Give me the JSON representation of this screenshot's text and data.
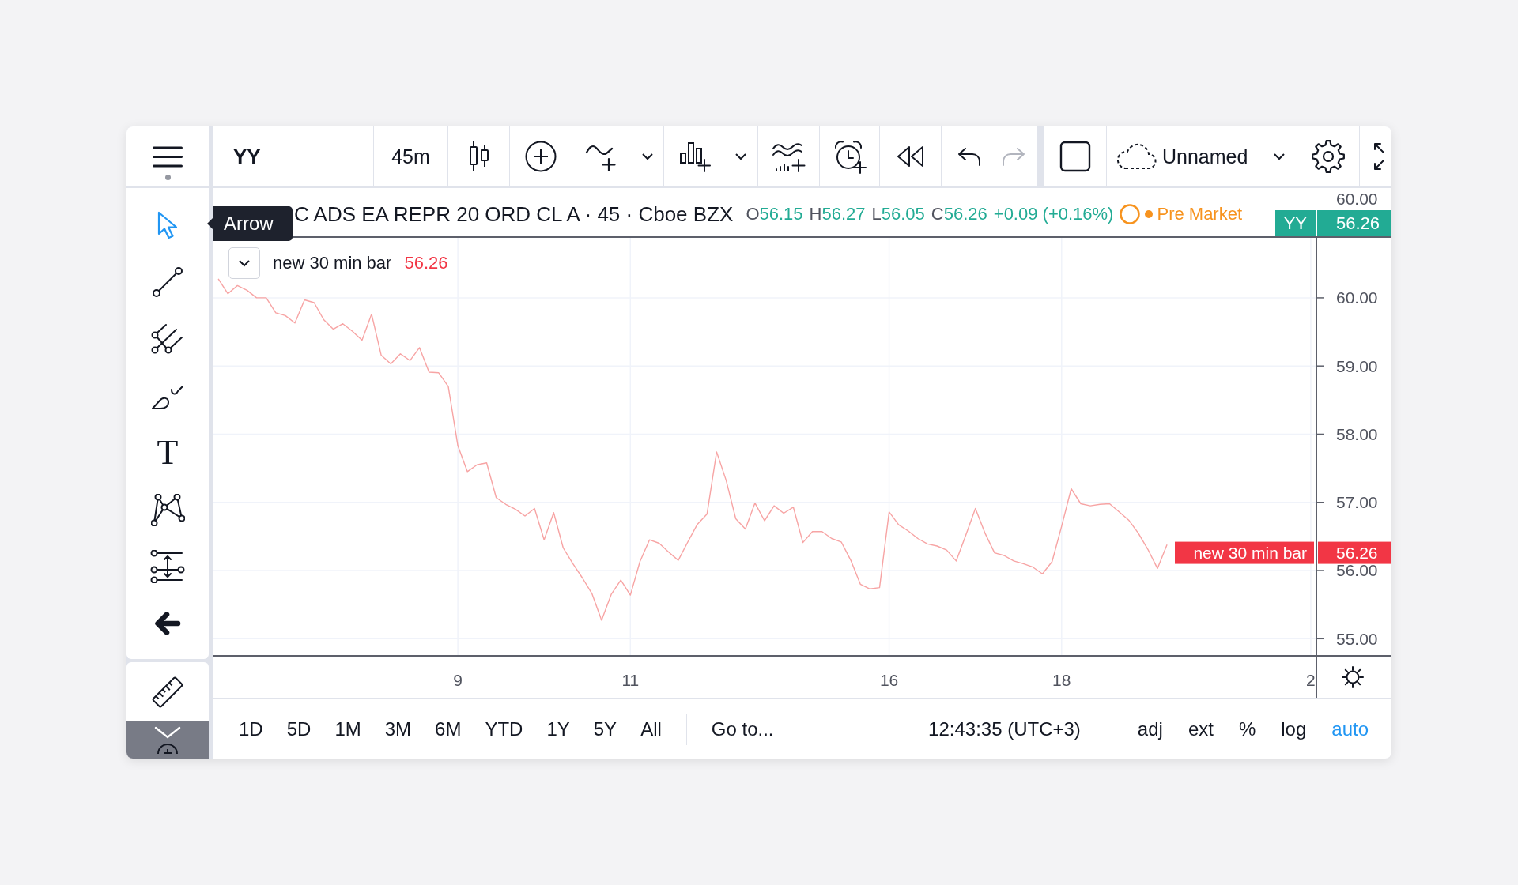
{
  "header": {
    "symbol": "YY",
    "interval": "45m",
    "undo": {
      "disabled": false
    },
    "redo": {
      "disabled": true
    },
    "layout_name": "Unnamed"
  },
  "left_toolbar": {
    "tooltip": "Arrow",
    "tools": [
      {
        "kind": "cursor",
        "selected": true
      },
      {
        "kind": "trend-line",
        "selected": false
      },
      {
        "kind": "fork",
        "selected": false
      },
      {
        "kind": "brush",
        "selected": false
      },
      {
        "kind": "text",
        "glyph": "T",
        "selected": false
      },
      {
        "kind": "pattern",
        "selected": false
      },
      {
        "kind": "measure",
        "selected": false
      },
      {
        "kind": "hide",
        "selected": false
      }
    ],
    "bottom_tools": [
      {
        "kind": "ruler",
        "selected": false
      }
    ]
  },
  "legend": {
    "title": "C ADS EA REPR 20 ORD CL A · 45 · Cboe BZX",
    "ohlc": [
      {
        "label": "O",
        "value": "56.15"
      },
      {
        "label": "H",
        "value": "56.27"
      },
      {
        "label": "L",
        "value": "56.05"
      },
      {
        "label": "C",
        "value": "56.26"
      }
    ],
    "change": "+0.09 (+0.16%)",
    "change_positive": true,
    "session": "Pre Market",
    "series_name": "new 30 min bar",
    "series_value": "56.26"
  },
  "top_pane": {
    "axis_label": "60.00",
    "symbol_tag": "YY",
    "price_tag": "56.26"
  },
  "chart": {
    "price_tag": {
      "value": "56.26"
    },
    "chart_data": {
      "type": "line",
      "categories": [
        null,
        null,
        null,
        null,
        null,
        null,
        null,
        null,
        null,
        null,
        null,
        null,
        null,
        null,
        null,
        null,
        null,
        null,
        null,
        null,
        null,
        null,
        null,
        null,
        null,
        "9",
        null,
        null,
        null,
        null,
        null,
        null,
        null,
        null,
        null,
        null,
        null,
        null,
        null,
        null,
        null,
        null,
        null,
        "11",
        null,
        null,
        null,
        null,
        null,
        null,
        null,
        null,
        null,
        null,
        null,
        null,
        null,
        null,
        null,
        null,
        null,
        null,
        null,
        null,
        null,
        null,
        null,
        null,
        null,
        null,
        "16",
        null,
        null,
        null,
        null,
        null,
        null,
        null,
        null,
        null,
        null,
        null,
        null,
        null,
        null,
        null,
        null,
        null,
        "18",
        null,
        null,
        null,
        null,
        null,
        null,
        null,
        null,
        null,
        null,
        null,
        null,
        null,
        null,
        null,
        null,
        null,
        null,
        null,
        null,
        null,
        null,
        null,
        null,
        null,
        "2"
      ],
      "series": [
        {
          "name": "new 30 min bar",
          "color": "#f7a4a4",
          "values": [
            60.28,
            60.06,
            60.18,
            60.11,
            60.0,
            60.0,
            59.78,
            59.74,
            59.63,
            59.97,
            59.93,
            59.68,
            59.54,
            59.62,
            59.51,
            59.38,
            59.76,
            59.16,
            59.03,
            59.18,
            59.08,
            59.27,
            58.91,
            58.9,
            58.7,
            57.83,
            57.45,
            57.55,
            57.58,
            57.07,
            56.97,
            56.9,
            56.8,
            56.91,
            56.45,
            56.85,
            56.33,
            56.1,
            55.89,
            55.66,
            55.27,
            55.65,
            55.86,
            55.64,
            56.13,
            56.45,
            56.4,
            56.27,
            56.15,
            56.42,
            56.68,
            56.83,
            57.74,
            57.32,
            56.76,
            56.61,
            56.99,
            56.73,
            56.95,
            56.84,
            56.93,
            56.41,
            56.57,
            56.57,
            56.47,
            56.42,
            56.15,
            55.8,
            55.73,
            55.75,
            56.86,
            56.67,
            56.58,
            56.47,
            56.39,
            56.36,
            56.3,
            56.14,
            56.52,
            56.91,
            56.55,
            56.26,
            56.22,
            56.14,
            56.1,
            56.05,
            55.95,
            56.13,
            56.65,
            57.2,
            56.98,
            56.95,
            56.97,
            56.98,
            56.86,
            56.74,
            56.55,
            56.31,
            56.03,
            56.38,
            null,
            null,
            null,
            null,
            null,
            null,
            null,
            null,
            null,
            null,
            null,
            null,
            null,
            null,
            null
          ]
        }
      ],
      "ylim": [
        54.76,
        60.88
      ],
      "yticks": [
        {
          "value": 55,
          "label": "55.00"
        },
        {
          "value": 56,
          "label": "56.00"
        },
        {
          "value": 57,
          "label": "57.00"
        },
        {
          "value": 58,
          "label": "58.00"
        },
        {
          "value": 59,
          "label": "59.00"
        },
        {
          "value": 60,
          "label": "60.00"
        }
      ],
      "grid": true
    }
  },
  "bottom_bar": {
    "ranges": [
      "1D",
      "5D",
      "1M",
      "3M",
      "6M",
      "YTD",
      "1Y",
      "5Y",
      "All"
    ],
    "goto": "Go to...",
    "time": "12:43:35 (UTC+3)",
    "options": [
      {
        "label": "adj",
        "on": false
      },
      {
        "label": "ext",
        "on": false
      },
      {
        "label": "%",
        "on": false
      },
      {
        "label": "log",
        "on": false
      },
      {
        "label": "auto",
        "on": true
      }
    ]
  }
}
